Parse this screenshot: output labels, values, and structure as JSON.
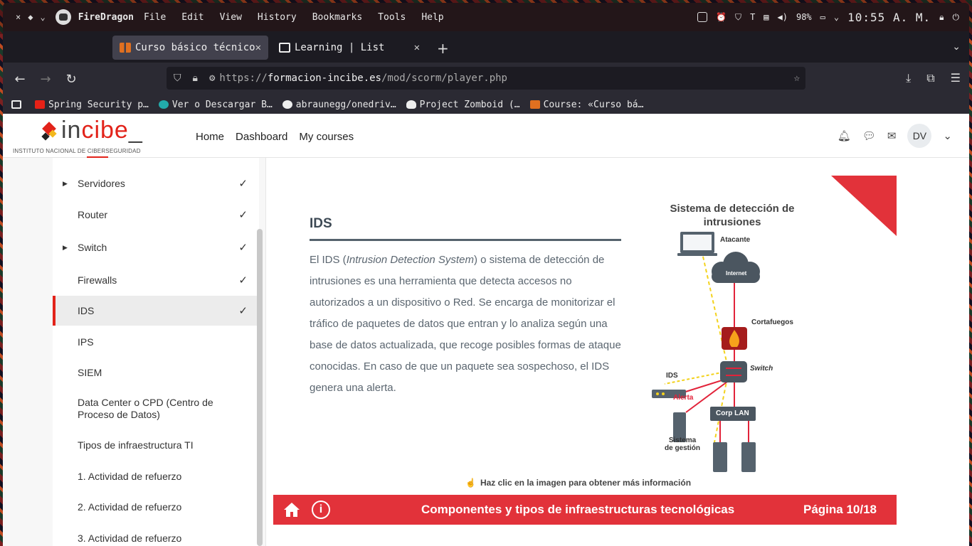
{
  "system": {
    "app_name": "FireDragon",
    "menus": [
      "File",
      "Edit",
      "View",
      "History",
      "Bookmarks",
      "Tools",
      "Help"
    ],
    "battery": "98%",
    "clock": "10:55 A. M."
  },
  "tabs": [
    {
      "label": "Curso básico técnico",
      "icon": "incibe-favicon"
    },
    {
      "label": "Learning | List",
      "icon": "notion-favicon"
    }
  ],
  "url": {
    "scheme": "https://",
    "host": "formacion-incibe.es",
    "path": "/mod/scorm/player.php"
  },
  "bookmarks": [
    {
      "label": "",
      "icon": "notion-icon"
    },
    {
      "label": "Spring Security p…",
      "icon": "youtube-icon"
    },
    {
      "label": "Ver o Descargar B…",
      "icon": "c-icon"
    },
    {
      "label": "abraunegg/onedriv…",
      "icon": "github-icon"
    },
    {
      "label": "Project Zomboid (…",
      "icon": "tux-icon"
    },
    {
      "label": "Course: «Curso bá…",
      "icon": "incibe-favicon"
    }
  ],
  "site": {
    "logo_text_1": "in",
    "logo_text_2": "cibe",
    "logo_text_3": "_",
    "logo_sub": "INSTITUTO NACIONAL DE CIBERSEGURIDAD",
    "nav": [
      "Home",
      "Dashboard",
      "My courses"
    ],
    "avatar": "DV"
  },
  "sidebar": [
    {
      "label": "Servidores",
      "arrow": true,
      "check": true
    },
    {
      "label": "Router",
      "arrow": false,
      "check": true
    },
    {
      "label": "Switch",
      "arrow": true,
      "check": true
    },
    {
      "label": "Firewalls",
      "arrow": false,
      "check": true
    },
    {
      "label": "IDS",
      "arrow": false,
      "check": true,
      "active": true
    },
    {
      "label": "IPS",
      "arrow": false,
      "check": false
    },
    {
      "label": "SIEM",
      "arrow": false,
      "check": false
    },
    {
      "label": "Data Center o CPD (Centro de Proceso de Datos)",
      "arrow": false,
      "check": false
    },
    {
      "label": "Tipos de infraestructura TI",
      "arrow": false,
      "check": false
    },
    {
      "label": "1. Actividad de refuerzo",
      "arrow": false,
      "check": false
    },
    {
      "label": "2. Actividad de refuerzo",
      "arrow": false,
      "check": false
    },
    {
      "label": "3. Actividad de refuerzo",
      "arrow": false,
      "check": false
    }
  ],
  "content": {
    "title": "IDS",
    "text_1": "El IDS (",
    "text_italic": "Intrusion Detection System",
    "text_2": ") o sistema de detección de intrusiones es una herramienta que detecta accesos no autorizados a un dispositivo o Red. Se encarga de monitorizar el tráfico de paquetes de datos que entran y lo analiza según una base de datos actualizada, que recoge posibles formas de ataque conocidas. En caso de que un paquete sea sospechoso, el IDS genera una alerta.",
    "diagram_title": "Sistema de detección de intrusiones",
    "diagram_labels": {
      "attacker": "Atacante",
      "internet": "Internet",
      "firewall": "Cortafuegos",
      "switch": "Switch",
      "ids": "IDS",
      "alert": "Alerta",
      "corp_lan": "Corp LAN",
      "management": "Sistema de gestión"
    },
    "hint": "Haz clic en la imagen para obtener más información"
  },
  "footer": {
    "title": "Componentes y tipos de infraestructuras tecnológicas",
    "page": "Página 10/18",
    "info": "i"
  },
  "colors": {
    "accent": "#e2323a",
    "brand_red": "#e2231a",
    "brand_yellow": "#f3b81d",
    "text": "#5b6670"
  }
}
